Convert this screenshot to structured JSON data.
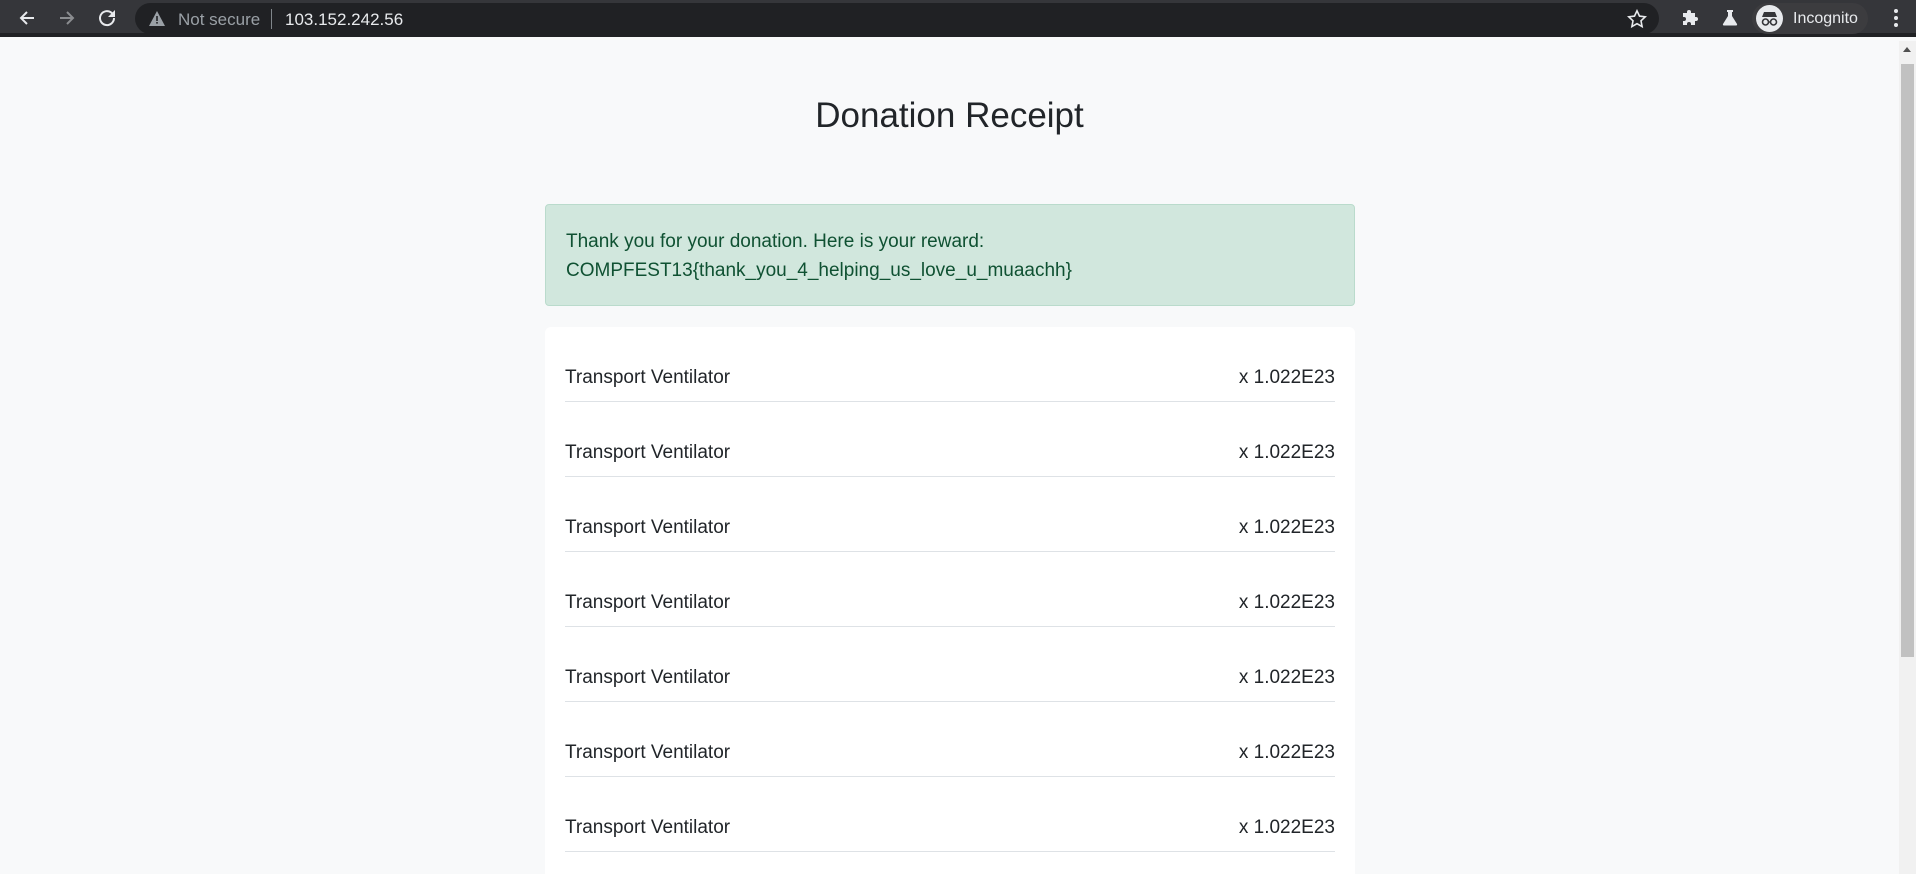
{
  "browser": {
    "security_label": "Not secure",
    "url": "103.152.242.56",
    "profile_label": "Incognito"
  },
  "page": {
    "title": "Donation Receipt",
    "alert_line1": "Thank you for your donation. Here is your reward:",
    "alert_line2": "COMPFEST13{thank_you_4_helping_us_love_u_muaachh}",
    "items": [
      {
        "name": "Transport Ventilator",
        "quantity": "x 1.022E23"
      },
      {
        "name": "Transport Ventilator",
        "quantity": "x 1.022E23"
      },
      {
        "name": "Transport Ventilator",
        "quantity": "x 1.022E23"
      },
      {
        "name": "Transport Ventilator",
        "quantity": "x 1.022E23"
      },
      {
        "name": "Transport Ventilator",
        "quantity": "x 1.022E23"
      },
      {
        "name": "Transport Ventilator",
        "quantity": "x 1.022E23"
      },
      {
        "name": "Transport Ventilator",
        "quantity": "x 1.022E23"
      }
    ]
  },
  "colors": {
    "alert_bg": "#d1e7dd",
    "alert_text": "#0f5132",
    "page_bg": "#f8f9fa",
    "chrome_bg": "#35363a"
  }
}
